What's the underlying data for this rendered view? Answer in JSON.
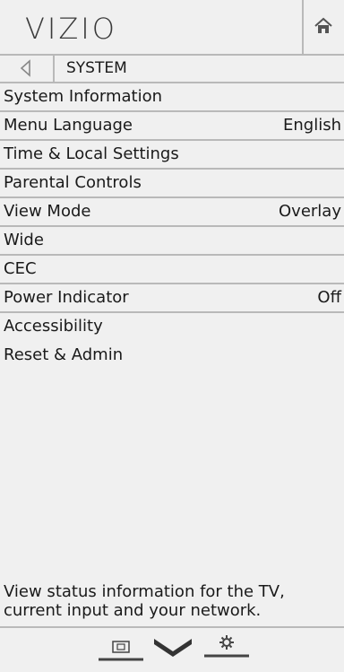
{
  "header": {
    "logo_text": "VIZIO"
  },
  "breadcrumb": {
    "label": "SYSTEM"
  },
  "menu": {
    "items": [
      {
        "label": "System Information",
        "value": ""
      },
      {
        "label": "Menu Language",
        "value": "English"
      },
      {
        "label": "Time & Local Settings",
        "value": ""
      },
      {
        "label": "Parental Controls",
        "value": ""
      },
      {
        "label": "View Mode",
        "value": "Overlay"
      },
      {
        "label": "Wide",
        "value": ""
      },
      {
        "label": "CEC",
        "value": ""
      },
      {
        "label": "Power Indicator",
        "value": "Off"
      },
      {
        "label": "Accessibility",
        "value": ""
      },
      {
        "label": "Reset & Admin",
        "value": ""
      }
    ]
  },
  "help_text": "View status information for the TV, current input and your network.",
  "footer": {
    "icons": [
      "input-icon",
      "vizio-v-icon",
      "settings-icon"
    ]
  },
  "colors": {
    "background": "#f0f0f0",
    "divider": "#b9b9b9",
    "text": "#1a1a1a",
    "icon": "#3a3a3a"
  }
}
